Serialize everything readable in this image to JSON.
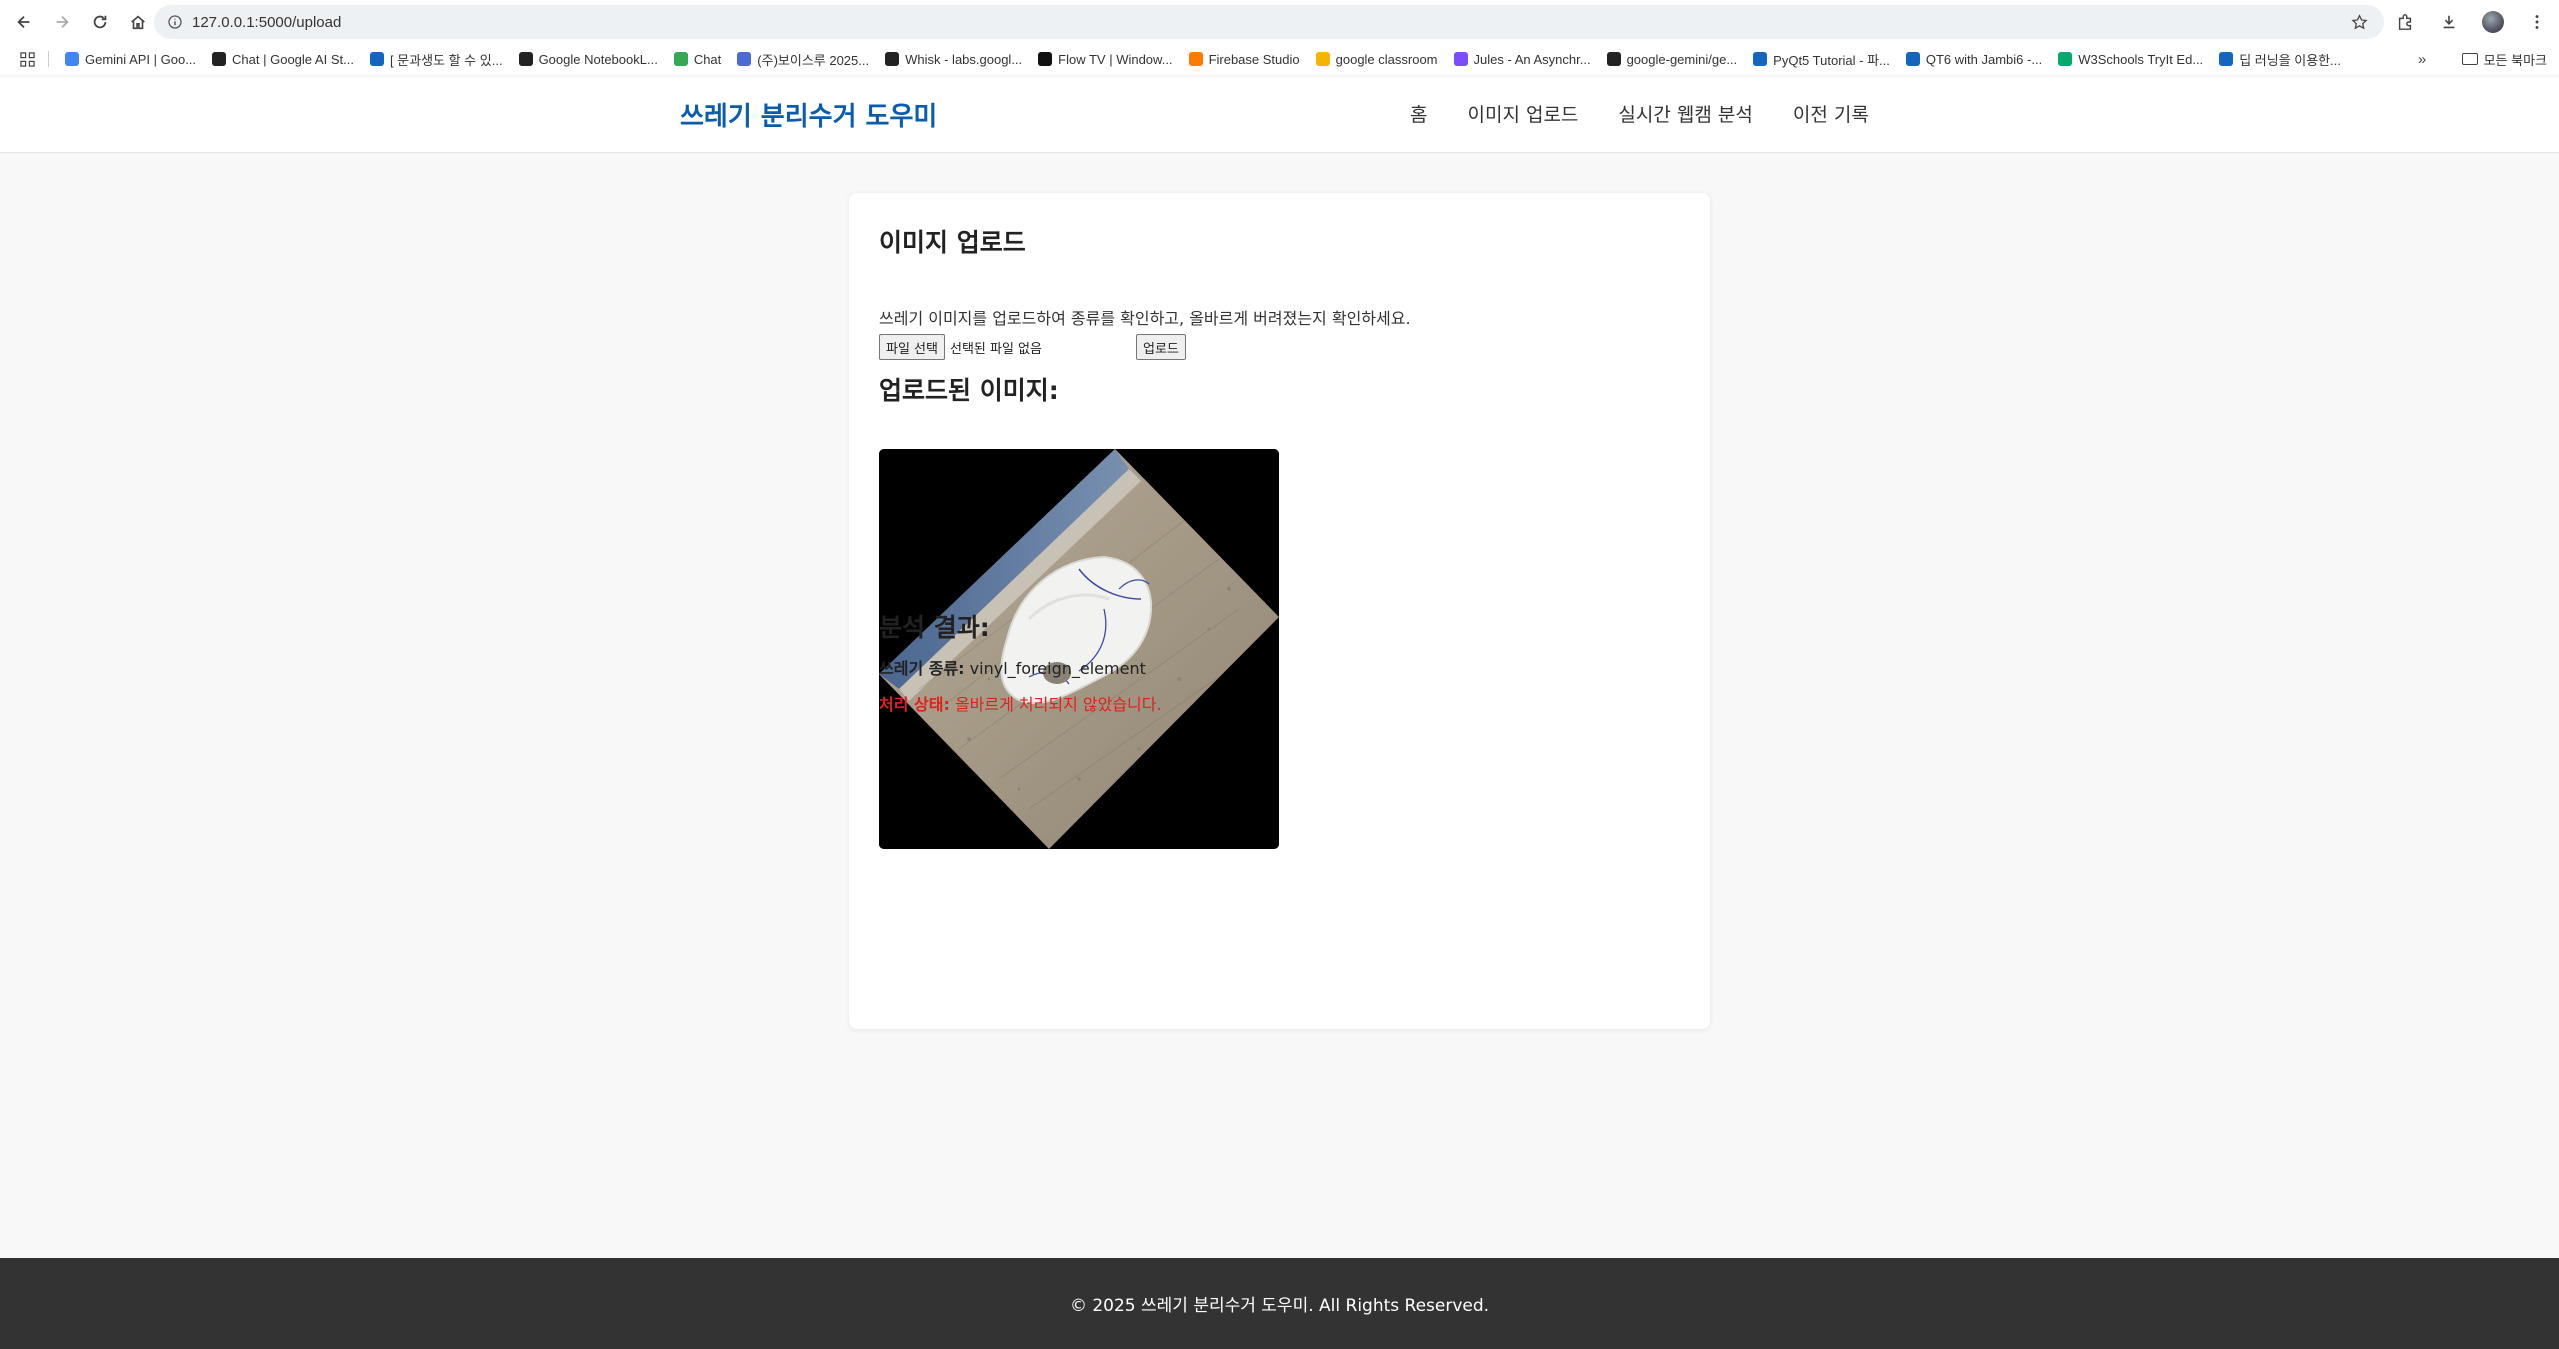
{
  "browser": {
    "url": "127.0.0.1:5000/upload",
    "bookmarks": [
      {
        "label": "Gemini API  |  Goo...",
        "icon": "google-icon",
        "color": "#4285f4"
      },
      {
        "label": "Chat | Google AI St...",
        "icon": "ai-studio-icon",
        "color": "#222222"
      },
      {
        "label": "[ 문과생도 할 수 있...",
        "icon": "bookmark-doc-icon",
        "color": "#1565c0"
      },
      {
        "label": "Google NotebookL...",
        "icon": "notebooklm-icon",
        "color": "#222222"
      },
      {
        "label": "Chat",
        "icon": "google-chat-icon",
        "color": "#34a853"
      },
      {
        "label": "(주)보이스루 2025...",
        "icon": "s-icon",
        "color": "#4a6cd4"
      },
      {
        "label": "Whisk - labs.googl...",
        "icon": "whisk-icon",
        "color": "#222222"
      },
      {
        "label": "Flow TV | Window...",
        "icon": "flow-icon",
        "color": "#111111"
      },
      {
        "label": "Firebase Studio",
        "icon": "firebase-icon",
        "color": "#ff7a00"
      },
      {
        "label": "google classroom",
        "icon": "classroom-icon",
        "color": "#f4b400"
      },
      {
        "label": "Jules - An Asynchr...",
        "icon": "jules-icon",
        "color": "#7c4dff"
      },
      {
        "label": "google-gemini/ge...",
        "icon": "github-icon",
        "color": "#222222"
      },
      {
        "label": "PyQt5 Tutorial - 파...",
        "icon": "bookmark-doc-icon",
        "color": "#1565c0"
      },
      {
        "label": "QT6 with Jambi6 -...",
        "icon": "bookmark-doc-icon",
        "color": "#1565c0"
      },
      {
        "label": "W3Schools TryIt Ed...",
        "icon": "w3schools-icon",
        "color": "#04aa6d"
      },
      {
        "label": "딥 러닝을 이용한...",
        "icon": "bookmark-doc-icon",
        "color": "#1565c0"
      }
    ],
    "all_bookmarks_label": "모든 북마크"
  },
  "header": {
    "logo": "쓰레기 분리수거 도우미",
    "nav": [
      "홈",
      "이미지 업로드",
      "실시간 웹캠 분석",
      "이전 기록"
    ]
  },
  "upload": {
    "title": "이미지 업로드",
    "description": "쓰레기 이미지를 업로드하여 종류를 확인하고, 올바르게 버려졌는지 확인하세요.",
    "choose_file_label": "파일 선택",
    "no_file_text": "선택된 파일 없음",
    "upload_button": "업로드"
  },
  "uploaded": {
    "title": "업로드된 이미지:"
  },
  "result": {
    "title": "분석 결과:",
    "type_label": "쓰레기 종류:",
    "type_value": "vinyl_foreign_element",
    "status_label": "처리 상태:",
    "status_value": "올바르게 처리되지 않았습니다.",
    "status_color": "#e0201c"
  },
  "footer": {
    "text": "© 2025 쓰레기 분리수거 도우미. All Rights Reserved."
  }
}
